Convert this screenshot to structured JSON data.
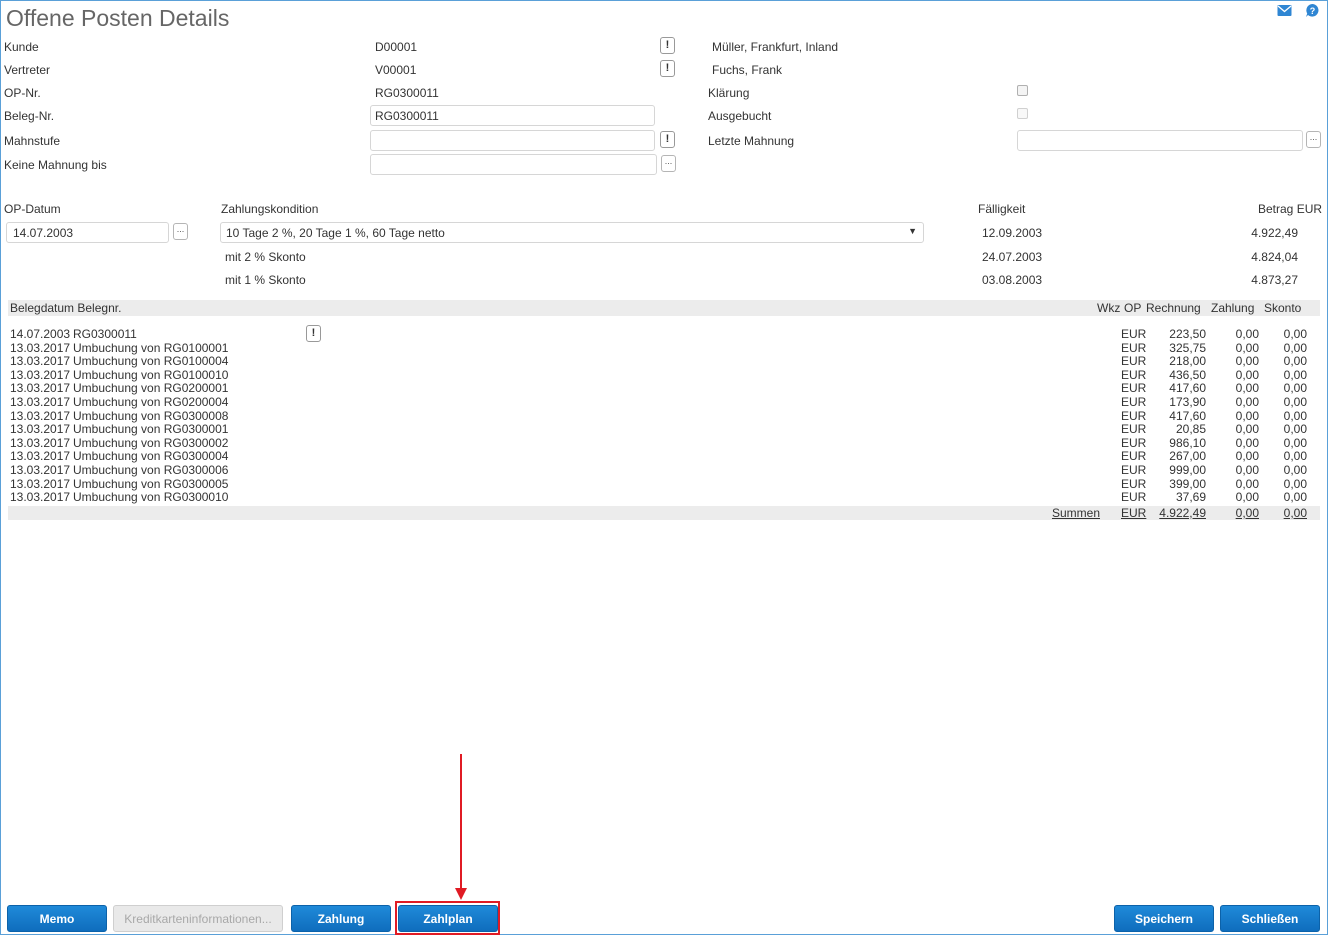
{
  "page": {
    "title": "Offene Posten Details"
  },
  "header_icons": [
    "mail-icon",
    "help-icon"
  ],
  "fields": {
    "kunde": {
      "label": "Kunde",
      "value": "D00001",
      "info": "Müller, Frankfurt, Inland"
    },
    "vertreter": {
      "label": "Vertreter",
      "value": "V00001",
      "info": "Fuchs, Frank"
    },
    "op_nr": {
      "label": "OP-Nr.",
      "value": "RG0300011"
    },
    "beleg_nr": {
      "label": "Beleg-Nr.",
      "value": "RG0300011"
    },
    "mahnstufe": {
      "label": "Mahnstufe",
      "value": ""
    },
    "keine_mahnung_bis": {
      "label": "Keine Mahnung bis",
      "value": ""
    },
    "klaerung": {
      "label": "Klärung",
      "checked": false
    },
    "ausgebucht": {
      "label": "Ausgebucht",
      "checked": false
    },
    "letzte_mahnung": {
      "label": "Letzte Mahnung",
      "value": ""
    }
  },
  "terms": {
    "op_datum_label": "OP-Datum",
    "op_datum": "14.07.2003",
    "zahlungskondition_label": "Zahlungskondition",
    "zahlungskondition": "10 Tage 2 %, 20 Tage 1 %, 60 Tage netto",
    "faelligkeit_label": "Fälligkeit",
    "betrag_label": "Betrag EUR",
    "rows": [
      {
        "text": "",
        "date": "12.09.2003",
        "amount": "4.922,49"
      },
      {
        "text": "mit 2 % Skonto",
        "date": "24.07.2003",
        "amount": "4.824,04"
      },
      {
        "text": "mit 1 % Skonto",
        "date": "03.08.2003",
        "amount": "4.873,27"
      }
    ]
  },
  "table": {
    "headers": {
      "left": "Belegdatum Belegnr.",
      "wkz": "Wkz",
      "op": "OP",
      "rechnung": "Rechnung",
      "zahlung": "Zahlung",
      "skonto": "Skonto"
    },
    "rows": [
      {
        "date": "14.07.2003",
        "text": "RG0300011",
        "wkz": "EUR",
        "rechnung": "223,50",
        "zahlung": "0,00",
        "skonto": "0,00"
      },
      {
        "date": "13.03.2017",
        "text": "Umbuchung von RG0100001",
        "wkz": "EUR",
        "rechnung": "325,75",
        "zahlung": "0,00",
        "skonto": "0,00"
      },
      {
        "date": "13.03.2017",
        "text": "Umbuchung von RG0100004",
        "wkz": "EUR",
        "rechnung": "218,00",
        "zahlung": "0,00",
        "skonto": "0,00"
      },
      {
        "date": "13.03.2017",
        "text": "Umbuchung von RG0100010",
        "wkz": "EUR",
        "rechnung": "436,50",
        "zahlung": "0,00",
        "skonto": "0,00"
      },
      {
        "date": "13.03.2017",
        "text": "Umbuchung von RG0200001",
        "wkz": "EUR",
        "rechnung": "417,60",
        "zahlung": "0,00",
        "skonto": "0,00"
      },
      {
        "date": "13.03.2017",
        "text": "Umbuchung von RG0200004",
        "wkz": "EUR",
        "rechnung": "173,90",
        "zahlung": "0,00",
        "skonto": "0,00"
      },
      {
        "date": "13.03.2017",
        "text": "Umbuchung von RG0300008",
        "wkz": "EUR",
        "rechnung": "417,60",
        "zahlung": "0,00",
        "skonto": "0,00"
      },
      {
        "date": "13.03.2017",
        "text": "Umbuchung von RG0300001",
        "wkz": "EUR",
        "rechnung": "20,85",
        "zahlung": "0,00",
        "skonto": "0,00"
      },
      {
        "date": "13.03.2017",
        "text": "Umbuchung von RG0300002",
        "wkz": "EUR",
        "rechnung": "986,10",
        "zahlung": "0,00",
        "skonto": "0,00"
      },
      {
        "date": "13.03.2017",
        "text": "Umbuchung von RG0300004",
        "wkz": "EUR",
        "rechnung": "267,00",
        "zahlung": "0,00",
        "skonto": "0,00"
      },
      {
        "date": "13.03.2017",
        "text": "Umbuchung von RG0300006",
        "wkz": "EUR",
        "rechnung": "999,00",
        "zahlung": "0,00",
        "skonto": "0,00"
      },
      {
        "date": "13.03.2017",
        "text": "Umbuchung von RG0300005",
        "wkz": "EUR",
        "rechnung": "399,00",
        "zahlung": "0,00",
        "skonto": "0,00"
      },
      {
        "date": "13.03.2017",
        "text": "Umbuchung von RG0300010",
        "wkz": "EUR",
        "rechnung": "37,69",
        "zahlung": "0,00",
        "skonto": "0,00"
      }
    ],
    "sum": {
      "label": "Summen",
      "wkz": "EUR",
      "rechnung": "4.922,49",
      "zahlung": "0,00",
      "skonto": "0,00"
    }
  },
  "buttons": {
    "memo": "Memo",
    "kreditkarte": "Kreditkarteninformationen...",
    "zahlung": "Zahlung",
    "zahlplan": "Zahlplan",
    "speichern": "Speichern",
    "schliessen": "Schließen"
  },
  "colors": {
    "accent": "#1f8ad9",
    "annotation": "#e01b24",
    "header_bg": "#ececec"
  }
}
